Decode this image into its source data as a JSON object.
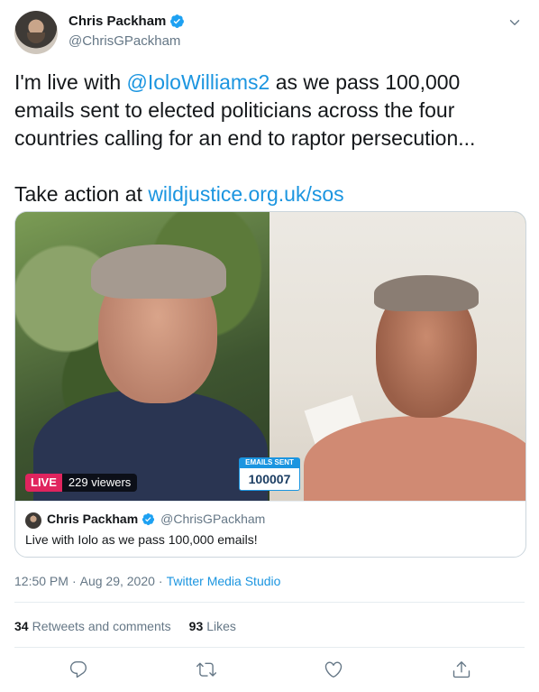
{
  "author": {
    "name": "Chris Packham",
    "handle": "@ChrisGPackham"
  },
  "tweet": {
    "text_before_mention": "I'm live with ",
    "mention": "@IoloWilliams2",
    "text_after_mention": " as we pass 100,000 emails sent to elected politicians across the four countries calling for an end to raptor persecution...",
    "cta_prefix": "Take action at ",
    "cta_link": "wildjustice.org.uk/sos"
  },
  "media": {
    "live_label": "LIVE",
    "viewers": "229 viewers",
    "counter_title": "EMAILS SENT",
    "counter_value": "100007",
    "card_author_name": "Chris Packham",
    "card_author_handle": "@ChrisGPackham",
    "card_text": "Live with Iolo as we pass 100,000 emails!"
  },
  "meta": {
    "time": "12:50 PM",
    "separator": "·",
    "date": "Aug 29, 2020",
    "separator2": "·",
    "source": "Twitter Media Studio"
  },
  "stats": {
    "retweets_count": "34",
    "retweets_label": "Retweets and comments",
    "likes_count": "93",
    "likes_label": "Likes"
  },
  "colors": {
    "link": "#1b95e0",
    "live_red": "#e0245e",
    "muted": "#657786"
  },
  "icons": [
    "verified-badge-icon",
    "chevron-down-icon",
    "reply-icon",
    "retweet-icon",
    "like-icon",
    "share-icon"
  ]
}
